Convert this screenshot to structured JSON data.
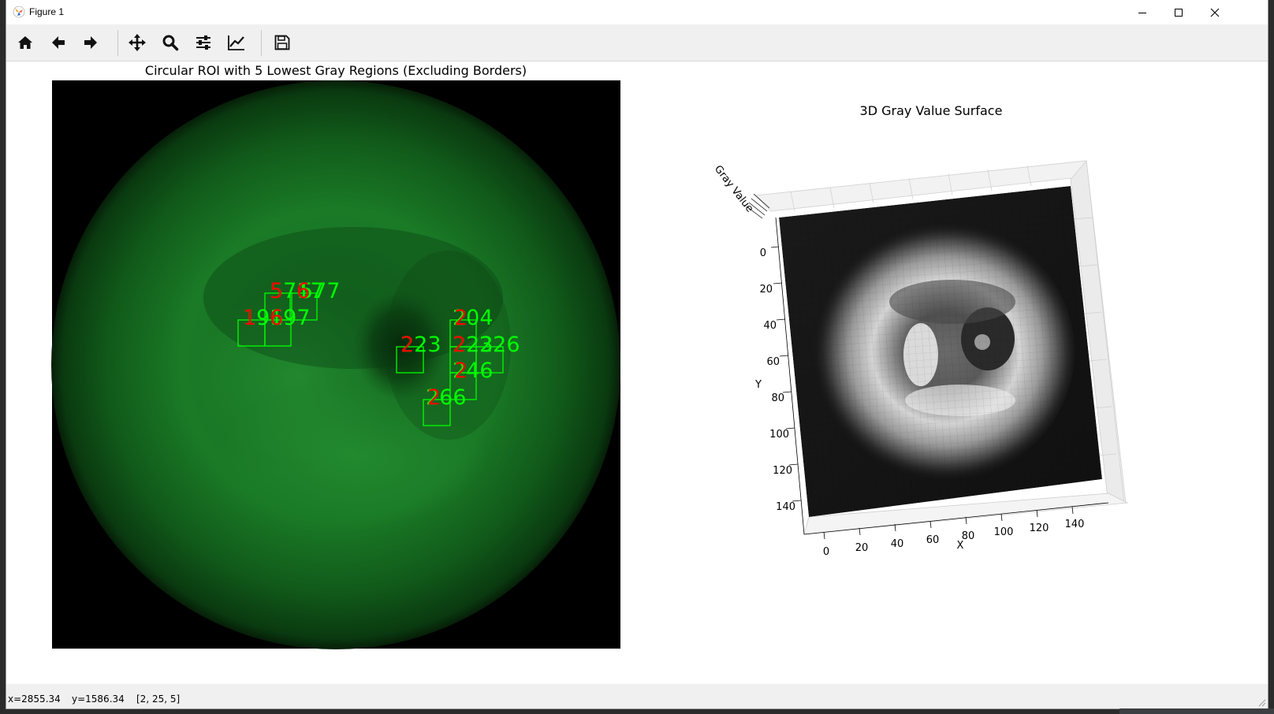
{
  "window": {
    "title": "Figure 1"
  },
  "toolbar": {
    "buttons": [
      {
        "name": "home",
        "icon": "home-icon"
      },
      {
        "name": "back",
        "icon": "arrow-left-icon"
      },
      {
        "name": "forward",
        "icon": "arrow-right-icon"
      },
      {
        "name": "pan",
        "icon": "move-icon"
      },
      {
        "name": "zoom",
        "icon": "magnifier-icon"
      },
      {
        "name": "configure-subplots",
        "icon": "sliders-icon"
      },
      {
        "name": "edit-axes",
        "icon": "line-chart-icon"
      },
      {
        "name": "save",
        "icon": "floppy-disk-icon"
      }
    ]
  },
  "status": {
    "x": "x=2855.34",
    "y": "y=1586.34",
    "value": "[2, 25, 5]"
  },
  "colors": {
    "roi_green": "#00ff00",
    "label_red": "#ff0000",
    "image_green": "#1a8a2a"
  },
  "figure": {
    "left_title": "Circular ROI with 5 Lowest Gray Regions (Excluding Borders)",
    "right_title": "3D Gray Value Surface",
    "roi_labels": [
      "5717",
      "577",
      "196",
      "197",
      "204",
      "223",
      "223",
      "226",
      "246",
      "266"
    ],
    "highlight_labels": [
      "5",
      "6",
      "1",
      "6",
      "2",
      "2",
      "2",
      "2",
      "2"
    ],
    "axis_3d": {
      "x_label": "X",
      "y_label": "Y",
      "z_label": "Gray Value",
      "x_ticks": [
        "0",
        "20",
        "40",
        "60",
        "80",
        "100",
        "120",
        "140"
      ],
      "y_ticks": [
        "0",
        "20",
        "40",
        "60",
        "80",
        "100",
        "120",
        "140"
      ]
    }
  }
}
